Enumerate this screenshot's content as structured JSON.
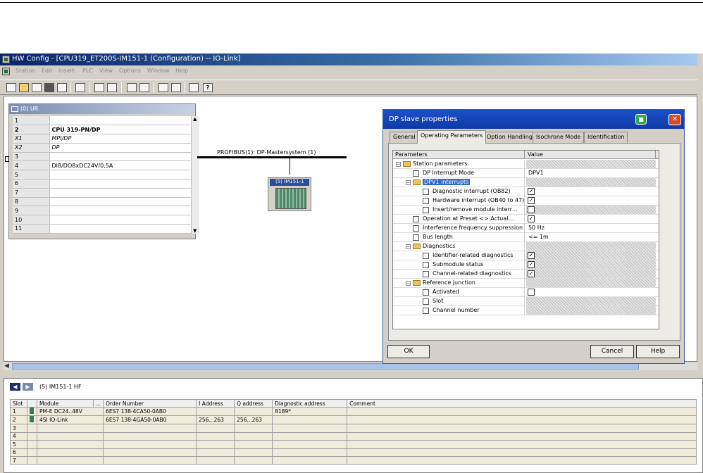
{
  "window": {
    "title": "HW Config - [CPU319_ET200S-IM151-1 (Configuration) -- IO-Link]"
  },
  "menu": [
    "Station",
    "Edit",
    "Insert",
    "PLC",
    "View",
    "Options",
    "Window",
    "Help"
  ],
  "toolbar": {
    "help_glyph": "?"
  },
  "rack": {
    "title": "(0) UR",
    "rows": [
      {
        "slot": "1",
        "module": "",
        "style": ""
      },
      {
        "slot": "2",
        "module": "CPU 319-PN/DP",
        "style": "bold"
      },
      {
        "slot": "X1",
        "module": "MPI/DP",
        "style": "ital"
      },
      {
        "slot": "X2",
        "module": "DP",
        "style": "ital"
      },
      {
        "slot": "3",
        "module": "",
        "style": ""
      },
      {
        "slot": "4",
        "module": "DI8/DO8xDC24V/0,5A",
        "style": ""
      },
      {
        "slot": "5",
        "module": "",
        "style": ""
      },
      {
        "slot": "6",
        "module": "",
        "style": ""
      },
      {
        "slot": "7",
        "module": "",
        "style": ""
      },
      {
        "slot": "8",
        "module": "",
        "style": ""
      },
      {
        "slot": "9",
        "module": "",
        "style": ""
      },
      {
        "slot": "10",
        "module": "",
        "style": ""
      },
      {
        "slot": "11",
        "module": "",
        "style": ""
      }
    ]
  },
  "network": {
    "bus_label": "PROFIBUS(1): DP-Mastersystem (1)",
    "station_label": "(5) IM151-1"
  },
  "dialog": {
    "title": "DP slave properties",
    "tabs": [
      "General",
      "Operating Parameters",
      "Option Handling",
      "Isochrone Mode",
      "Identification"
    ],
    "col_parameters": "Parameters",
    "col_value": "Value",
    "rows": [
      {
        "label": "Station parameters",
        "value": ""
      },
      {
        "label": "DP Interrupt Mode",
        "value": "DPV1"
      },
      {
        "label": "DPV1 interrupts",
        "value": ""
      },
      {
        "label": "Diagnostic interrupt (OB82)",
        "value": "✓"
      },
      {
        "label": "Hardware interrupt (OB40 to 47)",
        "value": "✓"
      },
      {
        "label": "Insert/remove module interr…",
        "value": ""
      },
      {
        "label": "Operation at Preset <> Actual…",
        "value": "✓"
      },
      {
        "label": "Interference frequency suppression",
        "value": "50 Hz"
      },
      {
        "label": "Bus length",
        "value": "<= 1m"
      },
      {
        "label": "Diagnostics",
        "value": ""
      },
      {
        "label": "Identifier-related diagnostics",
        "value": "✓"
      },
      {
        "label": "Submodule status",
        "value": "✓"
      },
      {
        "label": "Channel-related diagnostics",
        "value": "✓"
      },
      {
        "label": "Reference junction",
        "value": ""
      },
      {
        "label": "Activated",
        "value": ""
      },
      {
        "label": "Slot",
        "value": ""
      },
      {
        "label": "Channel number",
        "value": ""
      }
    ],
    "ok_label": "OK",
    "cancel_label": "Cancel",
    "help_label": "Help"
  },
  "modules": {
    "header_label": "(5)  IM151-1 HF",
    "columns": [
      "Slot",
      "",
      "Module",
      "...",
      "Order Number",
      "I Address",
      "Q address",
      "Diagnostic address",
      "Comment"
    ],
    "rows": [
      {
        "slot": "1",
        "module": "PM-E DC24..48V",
        "order": "6ES7 138-4CA50-0AB0",
        "iaddr": "",
        "qaddr": "",
        "diag": "8189*",
        "comment": ""
      },
      {
        "slot": "2",
        "module": "4SI IO-Link",
        "order": "6ES7 138-4GA50-0AB0",
        "iaddr": "256...263",
        "qaddr": "256...263",
        "diag": "",
        "comment": ""
      },
      {
        "slot": "3",
        "module": "",
        "order": "",
        "iaddr": "",
        "qaddr": "",
        "diag": "",
        "comment": ""
      },
      {
        "slot": "4",
        "module": "",
        "order": "",
        "iaddr": "",
        "qaddr": "",
        "diag": "",
        "comment": ""
      },
      {
        "slot": "5",
        "module": "",
        "order": "",
        "iaddr": "",
        "qaddr": "",
        "diag": "",
        "comment": ""
      },
      {
        "slot": "6",
        "module": "",
        "order": "",
        "iaddr": "",
        "qaddr": "",
        "diag": "",
        "comment": ""
      },
      {
        "slot": "7",
        "module": "",
        "order": "",
        "iaddr": "",
        "qaddr": "",
        "diag": "",
        "comment": ""
      }
    ]
  }
}
